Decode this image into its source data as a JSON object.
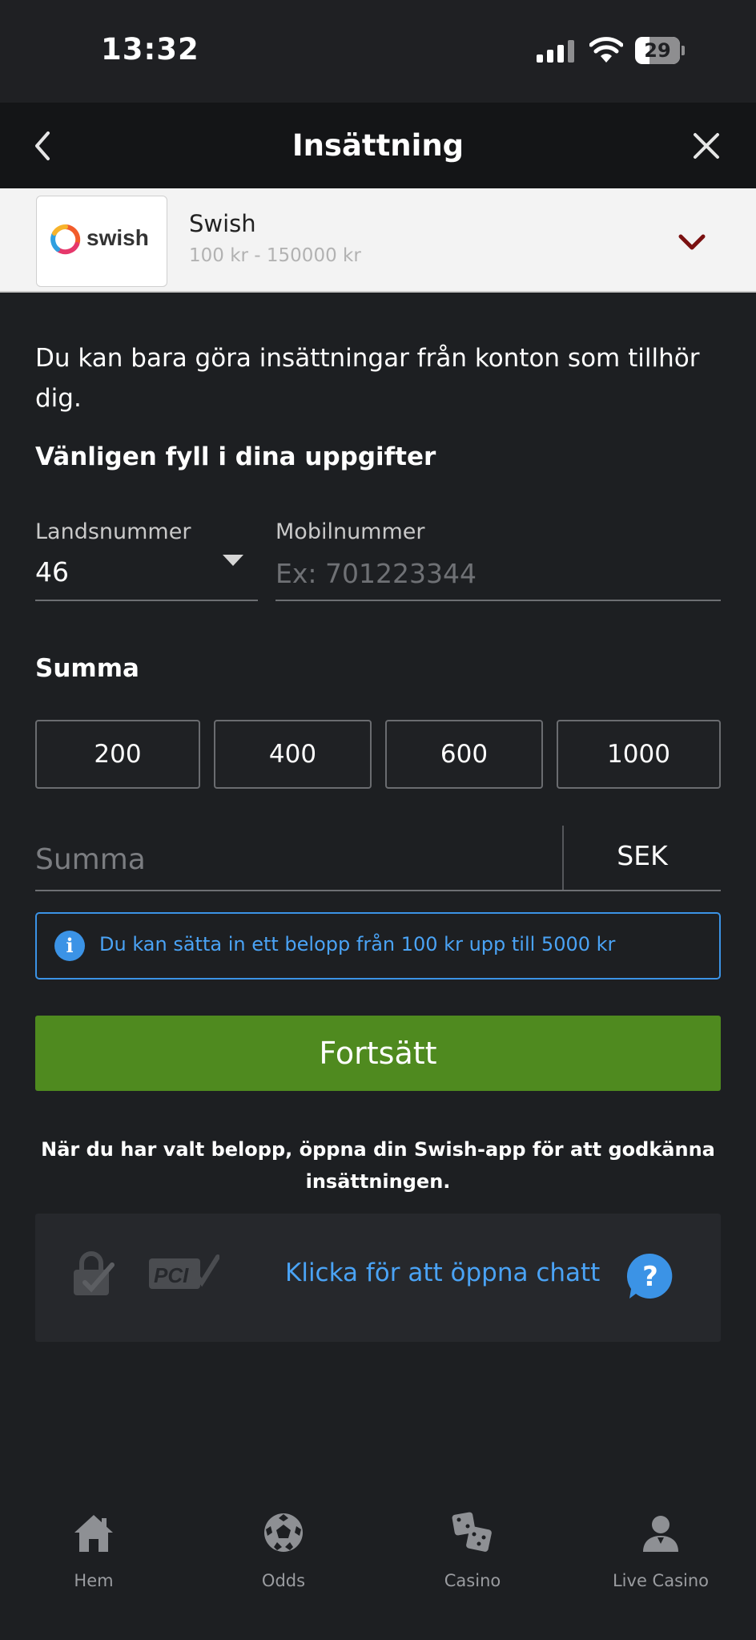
{
  "status_bar": {
    "time": "13:32",
    "battery": "29"
  },
  "header": {
    "title": "Insättning"
  },
  "payment_method": {
    "name": "Swish",
    "range": "100 kr - 150000 kr",
    "logo_text": "swish"
  },
  "info_text": "Du kan bara göra insättningar från konton som tillhör dig.",
  "details": {
    "title": "Vänligen fyll i dina uppgifter",
    "country_code_label": "Landsnummer",
    "country_code_value": "46",
    "mobile_label": "Mobilnummer",
    "mobile_placeholder": "Ex: 701223344"
  },
  "amount": {
    "title": "Summa",
    "presets": [
      "200",
      "400",
      "600",
      "1000"
    ],
    "input_placeholder": "Summa",
    "currency": "SEK"
  },
  "notice": {
    "icon": "i",
    "text": "Du kan sätta in ett belopp från 100 kr upp till 5000 kr"
  },
  "continue_label": "Fortsätt",
  "hint": "När du har valt belopp, öppna din Swish-app för att godkänna insättningen.",
  "chat": {
    "link": "Klicka för att öppna chatt"
  },
  "nav": [
    {
      "label": "Hem",
      "icon": "home-icon"
    },
    {
      "label": "Odds",
      "icon": "football-icon"
    },
    {
      "label": "Casino",
      "icon": "dice-icon"
    },
    {
      "label": "Live Casino",
      "icon": "dealer-icon"
    }
  ],
  "colors": {
    "accent_green": "#4f8a1f",
    "info_blue": "#3b93e6",
    "chevron": "#7a1010"
  }
}
